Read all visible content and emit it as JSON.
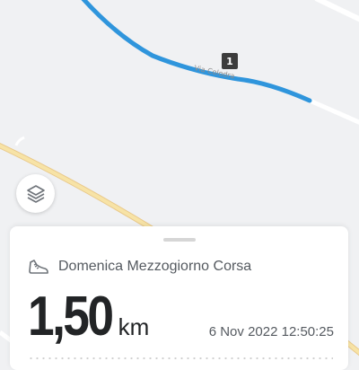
{
  "map": {
    "road_label": "Via Colodra",
    "lap_marker": "1",
    "colors": {
      "route": "#2f95dc",
      "major_road": "#f3d38a",
      "minor_road": "#ffffff"
    }
  },
  "controls": {
    "layers_icon": "layers-icon"
  },
  "activity": {
    "icon": "running-shoe-icon",
    "title": "Domenica Mezzogiorno Corsa",
    "distance_value": "1,50",
    "distance_unit": "km",
    "date": "6 Nov 2022 12:50:25"
  }
}
